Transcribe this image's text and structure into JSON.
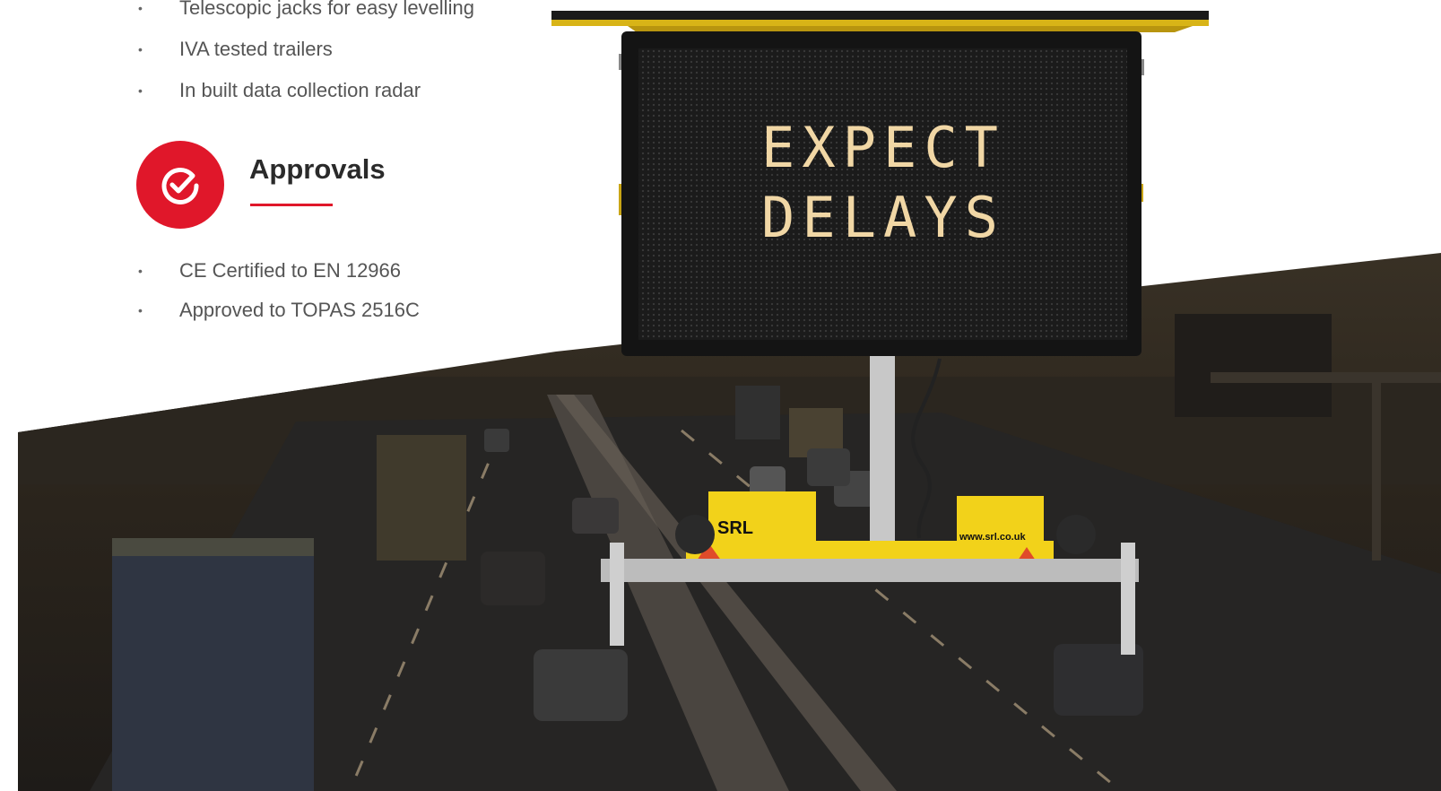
{
  "features": {
    "items": [
      "Telescopic jacks for easy levelling",
      "IVA tested trailers",
      "In built data collection radar"
    ]
  },
  "approvals": {
    "title": "Approvals",
    "icon": "check-circle-icon",
    "items": [
      "CE Certified to EN 12966",
      "Approved to TOPAS 2516C"
    ]
  },
  "sign": {
    "line1": "EXPECT",
    "line2": "DELAYS",
    "trailer_brand": "SRL",
    "trailer_url": "www.srl.co.uk"
  },
  "colors": {
    "accent": "#e0172a",
    "text": "#555555",
    "heading": "#2a2a2a",
    "led": "#f1d7a5"
  }
}
